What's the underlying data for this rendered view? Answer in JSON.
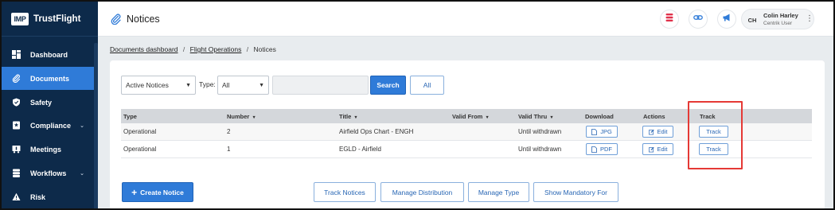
{
  "brand": {
    "logo_text": "IMP",
    "name": "TrustFlight"
  },
  "sidebar": {
    "items": [
      {
        "label": "Dashboard",
        "icon": "dashboard-icon",
        "expandable": false,
        "active": false
      },
      {
        "label": "Documents",
        "icon": "paperclip-icon",
        "expandable": false,
        "active": true
      },
      {
        "label": "Safety",
        "icon": "shield-icon",
        "expandable": false,
        "active": false
      },
      {
        "label": "Compliance",
        "icon": "compliance-icon",
        "expandable": true,
        "active": false
      },
      {
        "label": "Meetings",
        "icon": "meetings-icon",
        "expandable": false,
        "active": false
      },
      {
        "label": "Workflows",
        "icon": "workflows-icon",
        "expandable": true,
        "active": false
      },
      {
        "label": "Risk",
        "icon": "warning-icon",
        "expandable": false,
        "active": false
      }
    ],
    "chevron": "⌄"
  },
  "header": {
    "title": "Notices",
    "title_icon": "paperclip-icon",
    "actions": [
      "stack-icon",
      "link-icon",
      "megaphone-icon"
    ],
    "user": {
      "initials": "CH",
      "name": "Colin Harley",
      "role": "Centrik User",
      "menu_glyph": "⋮"
    }
  },
  "breadcrumb": {
    "items": [
      "Documents dashboard",
      "Flight Operations",
      "Notices"
    ],
    "separator": "/"
  },
  "filters": {
    "status_value": "Active Notices",
    "type_label": "Type:",
    "type_value": "All",
    "keyword_value": "",
    "search_label": "Search",
    "all_label": "All"
  },
  "table": {
    "columns": [
      "Type",
      "Number",
      "Title",
      "Valid From",
      "Valid Thru",
      "Download",
      "Actions",
      "Track"
    ],
    "sort_glyph": "▼",
    "rows": [
      {
        "type": "Operational",
        "number": "2",
        "title": "Airfield Ops Chart - ENGH",
        "valid_from": "",
        "valid_thru": "Until withdrawn",
        "download": "JPG",
        "action": "Edit",
        "track": "Track"
      },
      {
        "type": "Operational",
        "number": "1",
        "title": "EGLD - Airfield",
        "valid_from": "",
        "valid_thru": "Until withdrawn",
        "download": "PDF",
        "action": "Edit",
        "track": "Track"
      }
    ]
  },
  "footer": {
    "create_label": "Create Notice",
    "create_glyph": "+",
    "buttons": [
      "Track Notices",
      "Manage Distribution",
      "Manage Type",
      "Show Mandatory For"
    ]
  },
  "colors": {
    "sidebar_bg": "#0d2a4a",
    "accent": "#2f7bd8",
    "highlight": "#e53935"
  }
}
